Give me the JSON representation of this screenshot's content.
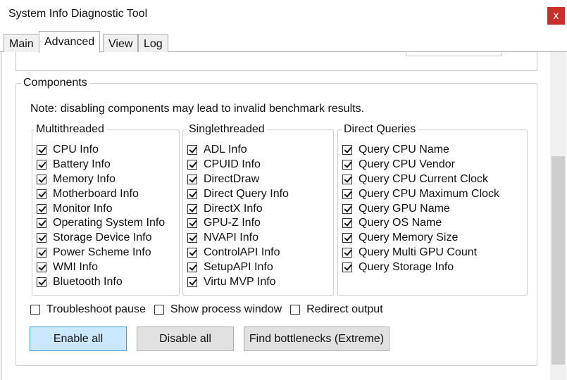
{
  "window": {
    "title": "System Info Diagnostic Tool",
    "close_glyph": "x"
  },
  "tabs": [
    {
      "label": "Main"
    },
    {
      "label": "Advanced"
    },
    {
      "label": "View"
    },
    {
      "label": "Log"
    }
  ],
  "active_tab": "Advanced",
  "components": {
    "title": "Components",
    "note": "Note: disabling components may lead to invalid benchmark results.",
    "groups": [
      {
        "title": "Multithreaded",
        "items": [
          {
            "label": "CPU Info",
            "checked": true
          },
          {
            "label": "Battery Info",
            "checked": true
          },
          {
            "label": "Memory Info",
            "checked": true
          },
          {
            "label": "Motherboard Info",
            "checked": true
          },
          {
            "label": "Monitor Info",
            "checked": true
          },
          {
            "label": "Operating System Info",
            "checked": true
          },
          {
            "label": "Storage Device Info",
            "checked": true
          },
          {
            "label": "Power Scheme Info",
            "checked": true
          },
          {
            "label": "WMI Info",
            "checked": true
          },
          {
            "label": "Bluetooth Info",
            "checked": true
          }
        ]
      },
      {
        "title": "Singlethreaded",
        "items": [
          {
            "label": "ADL Info",
            "checked": true
          },
          {
            "label": "CPUID Info",
            "checked": true
          },
          {
            "label": "DirectDraw",
            "checked": true
          },
          {
            "label": "Direct Query Info",
            "checked": true
          },
          {
            "label": "DirectX Info",
            "checked": true
          },
          {
            "label": "GPU-Z Info",
            "checked": true
          },
          {
            "label": "NVAPI Info",
            "checked": true
          },
          {
            "label": "ControlAPI Info",
            "checked": true
          },
          {
            "label": "SetupAPI Info",
            "checked": true
          },
          {
            "label": "Virtu MVP Info",
            "checked": true
          }
        ]
      },
      {
        "title": "Direct Queries",
        "items": [
          {
            "label": "Query CPU Name",
            "checked": true
          },
          {
            "label": "Query CPU Vendor",
            "checked": true
          },
          {
            "label": "Query CPU Current Clock",
            "checked": true
          },
          {
            "label": "Query CPU Maximum Clock",
            "checked": true
          },
          {
            "label": "Query GPU Name",
            "checked": true
          },
          {
            "label": "Query OS Name",
            "checked": true
          },
          {
            "label": "Query Memory Size",
            "checked": true
          },
          {
            "label": "Query Multi GPU Count",
            "checked": true
          },
          {
            "label": "Query Storage Info",
            "checked": true
          }
        ]
      }
    ],
    "options": [
      {
        "label": "Troubleshoot pause",
        "checked": false
      },
      {
        "label": "Show process window",
        "checked": false
      },
      {
        "label": "Redirect output",
        "checked": false
      }
    ],
    "buttons": {
      "enable_all": "Enable all",
      "disable_all": "Disable all",
      "find_bottlenecks": "Find bottlenecks (Extreme)"
    }
  },
  "colors": {
    "close_button": "#c9302c",
    "primary_button_bg": "#cce8ff",
    "primary_button_border": "#3c9ae0"
  }
}
